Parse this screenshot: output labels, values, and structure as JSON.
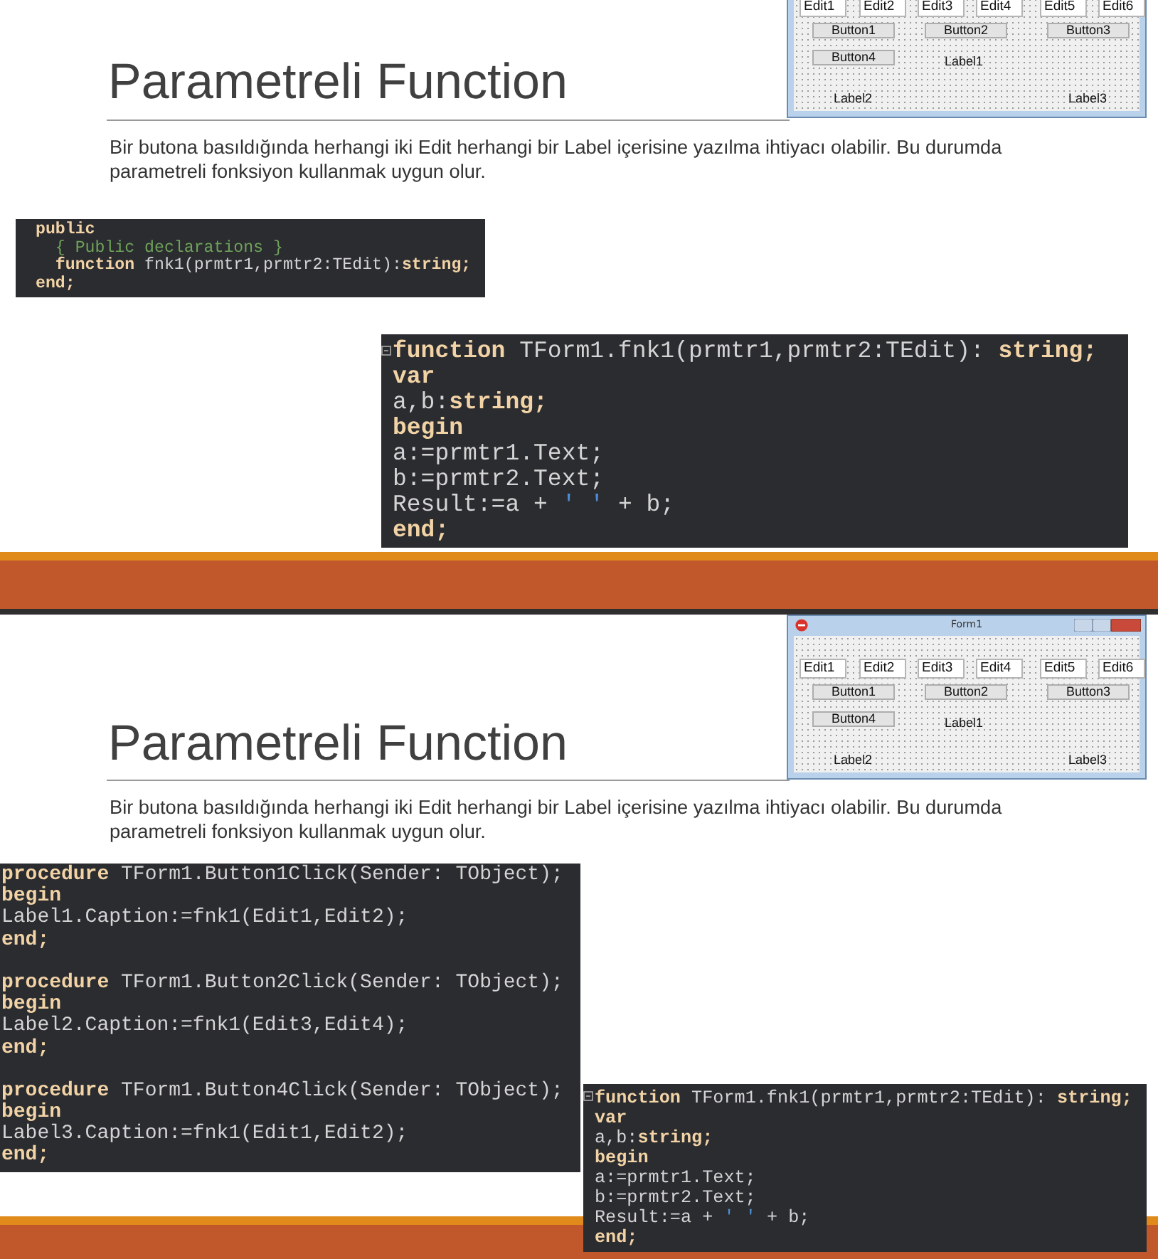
{
  "slides": [
    {
      "title": "Parametreli Function",
      "text": "Bir butona basıldığında herhangi iki Edit herhangi bir Label içerisine yazılma ihtiyacı olabilir. Bu durumda parametreli fonksiyon kullanmak uygun olur.",
      "form": {
        "edits": [
          "Edit1",
          "Edit2",
          "Edit3",
          "Edit4",
          "Edit5",
          "Edit6"
        ],
        "buttons": [
          "Button1",
          "Button2",
          "Button3",
          "Button4"
        ],
        "labels": [
          "Label1",
          "Label2",
          "Label3"
        ]
      },
      "code_blocks": [
        {
          "lines": [
            {
              "kind": "code",
              "tokens": [
                {
                  "kind": "kw",
                  "text": "public"
                }
              ]
            },
            {
              "kind": "code",
              "tokens": [
                {
                  "kind": "comment",
                  "text": "  { Public declarations }"
                }
              ]
            },
            {
              "kind": "code",
              "tokens": [
                {
                  "kind": "kw",
                  "text": "  function"
                },
                {
                  "kind": "plain",
                  "text": " fnk1(prmtr1,prmtr2:TEdit):"
                },
                {
                  "kind": "kw",
                  "text": "string;"
                }
              ]
            },
            {
              "kind": "code",
              "tokens": [
                {
                  "kind": "kw",
                  "text": "end;"
                }
              ]
            }
          ]
        },
        {
          "folded": false,
          "lines": [
            {
              "kind": "code",
              "tokens": [
                {
                  "kind": "kw",
                  "text": "function"
                },
                {
                  "kind": "plain",
                  "text": " TForm1.fnk1(prmtr1,prmtr2:TEdit): "
                },
                {
                  "kind": "kw",
                  "text": "string;"
                }
              ]
            },
            {
              "kind": "code",
              "tokens": [
                {
                  "kind": "kw",
                  "text": "var"
                }
              ]
            },
            {
              "kind": "code",
              "tokens": [
                {
                  "kind": "plain",
                  "text": "a,b:"
                },
                {
                  "kind": "kw",
                  "text": "string;"
                }
              ]
            },
            {
              "kind": "code",
              "tokens": [
                {
                  "kind": "kw",
                  "text": "begin"
                }
              ]
            },
            {
              "kind": "code",
              "tokens": [
                {
                  "kind": "plain",
                  "text": "a:=prmtr1.Text;"
                }
              ]
            },
            {
              "kind": "code",
              "tokens": [
                {
                  "kind": "plain",
                  "text": "b:=prmtr2.Text;"
                }
              ]
            },
            {
              "kind": "code",
              "tokens": [
                {
                  "kind": "plain",
                  "text": "Result:=a + "
                },
                {
                  "kind": "string",
                  "text": "' '"
                },
                {
                  "kind": "plain",
                  "text": " + b;"
                }
              ]
            },
            {
              "kind": "code",
              "tokens": [
                {
                  "kind": "kw",
                  "text": "end;"
                }
              ]
            }
          ]
        }
      ]
    },
    {
      "title": "Parametreli Function",
      "text": "Bir butona basıldığında herhangi iki Edit herhangi bir Label içerisine yazılma ihtiyacı olabilir. Bu durumda parametreli fonksiyon kullanmak uygun olur.",
      "form": {
        "title": "Form1",
        "edits": [
          "Edit1",
          "Edit2",
          "Edit3",
          "Edit4",
          "Edit5",
          "Edit6"
        ],
        "buttons": [
          "Button1",
          "Button2",
          "Button3",
          "Button4"
        ],
        "labels": [
          "Label1",
          "Label2",
          "Label3"
        ]
      },
      "code_blocks": [
        {
          "lines": [
            {
              "kind": "code",
              "tokens": [
                {
                  "kind": "kw",
                  "text": "procedure"
                },
                {
                  "kind": "plain",
                  "text": " TForm1.Button1Click(Sender: TObject);"
                }
              ]
            },
            {
              "kind": "code",
              "tokens": [
                {
                  "kind": "kw",
                  "text": "begin"
                }
              ]
            },
            {
              "kind": "code",
              "tokens": [
                {
                  "kind": "plain",
                  "text": "Label1.Caption:=fnk1(Edit1,Edit2);"
                }
              ]
            },
            {
              "kind": "code",
              "tokens": [
                {
                  "kind": "kw",
                  "text": "end;"
                }
              ]
            },
            {
              "kind": "blank"
            },
            {
              "kind": "code",
              "tokens": [
                {
                  "kind": "kw",
                  "text": "procedure"
                },
                {
                  "kind": "plain",
                  "text": " TForm1.Button2Click(Sender: TObject);"
                }
              ]
            },
            {
              "kind": "code",
              "tokens": [
                {
                  "kind": "kw",
                  "text": "begin"
                }
              ]
            },
            {
              "kind": "code",
              "tokens": [
                {
                  "kind": "plain",
                  "text": "Label2.Caption:=fnk1(Edit3,Edit4);"
                }
              ]
            },
            {
              "kind": "code",
              "tokens": [
                {
                  "kind": "kw",
                  "text": "end;"
                }
              ]
            },
            {
              "kind": "blank"
            },
            {
              "kind": "code",
              "tokens": [
                {
                  "kind": "kw",
                  "text": "procedure"
                },
                {
                  "kind": "plain",
                  "text": " TForm1.Button4Click(Sender: TObject);"
                }
              ]
            },
            {
              "kind": "code",
              "tokens": [
                {
                  "kind": "kw",
                  "text": "begin"
                }
              ]
            },
            {
              "kind": "code",
              "tokens": [
                {
                  "kind": "plain",
                  "text": "Label3.Caption:=fnk1(Edit1,Edit2);"
                }
              ]
            },
            {
              "kind": "code",
              "tokens": [
                {
                  "kind": "kw",
                  "text": "end;"
                }
              ]
            }
          ]
        },
        {
          "folded": false,
          "lines": [
            {
              "kind": "code",
              "tokens": [
                {
                  "kind": "kw",
                  "text": "function"
                },
                {
                  "kind": "plain",
                  "text": " TForm1.fnk1(prmtr1,prmtr2:TEdit): "
                },
                {
                  "kind": "kw",
                  "text": "string;"
                }
              ]
            },
            {
              "kind": "code",
              "tokens": [
                {
                  "kind": "kw",
                  "text": "var"
                }
              ]
            },
            {
              "kind": "code",
              "tokens": [
                {
                  "kind": "plain",
                  "text": "a,b:"
                },
                {
                  "kind": "kw",
                  "text": "string;"
                }
              ]
            },
            {
              "kind": "code",
              "tokens": [
                {
                  "kind": "kw",
                  "text": "begin"
                }
              ]
            },
            {
              "kind": "code",
              "tokens": [
                {
                  "kind": "plain",
                  "text": "a:=prmtr1.Text;"
                }
              ]
            },
            {
              "kind": "code",
              "tokens": [
                {
                  "kind": "plain",
                  "text": "b:=prmtr2.Text;"
                }
              ]
            },
            {
              "kind": "code",
              "tokens": [
                {
                  "kind": "plain",
                  "text": "Result:=a + "
                },
                {
                  "kind": "string",
                  "text": "' '"
                },
                {
                  "kind": "plain",
                  "text": " + b;"
                }
              ]
            },
            {
              "kind": "code",
              "tokens": [
                {
                  "kind": "kw",
                  "text": "end;"
                }
              ]
            }
          ]
        }
      ]
    }
  ]
}
